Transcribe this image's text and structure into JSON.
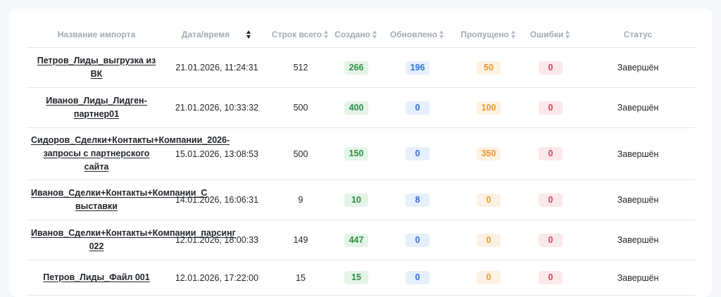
{
  "headers": {
    "name": "Название импорта",
    "datetime": "Дата/время",
    "rows_total": "Строк всего",
    "created": "Создано",
    "updated": "Обновлено",
    "skipped": "Пропущено",
    "errors": "Ошибки",
    "status": "Статус"
  },
  "rows": [
    {
      "name": "Петров_Лиды_выгрузка из ВК",
      "datetime": "21.01.2026, 11:24:31",
      "rows_total": "512",
      "created": "266",
      "updated": "196",
      "skipped": "50",
      "errors": "0",
      "status": "Завершён"
    },
    {
      "name": "Иванов_Лиды_Лидген-партнер01",
      "datetime": "21.01.2026, 10:33:32",
      "rows_total": "500",
      "created": "400",
      "updated": "0",
      "skipped": "100",
      "errors": "0",
      "status": "Завершён"
    },
    {
      "name": "Сидоров_Сделки+Контакты+Компании_2026-запросы с партнерского сайта",
      "datetime": "15.01.2026, 13:08:53",
      "rows_total": "500",
      "created": "150",
      "updated": "0",
      "skipped": "350",
      "errors": "0",
      "status": "Завершён"
    },
    {
      "name": "Иванов_Сделки+Контакты+Компании_С выставки",
      "datetime": "14.01.2026, 16:06:31",
      "rows_total": "9",
      "created": "10",
      "updated": "8",
      "skipped": "0",
      "errors": "0",
      "status": "Завершён"
    },
    {
      "name": "Иванов_Сделки+Контакты+Компании_парсинг 022",
      "datetime": "12.01.2026, 18:00:33",
      "rows_total": "149",
      "created": "447",
      "updated": "0",
      "skipped": "0",
      "errors": "0",
      "status": "Завершён"
    },
    {
      "name": "Петров_Лиды_Файл 001",
      "datetime": "12.01.2026, 17:22:00",
      "rows_total": "15",
      "created": "15",
      "updated": "0",
      "skipped": "0",
      "errors": "0",
      "status": "Завершён"
    }
  ],
  "colors": {
    "created": "#2f8f46",
    "updated": "#2f6fd8",
    "skipped": "#f0982e",
    "errors": "#d84352"
  }
}
